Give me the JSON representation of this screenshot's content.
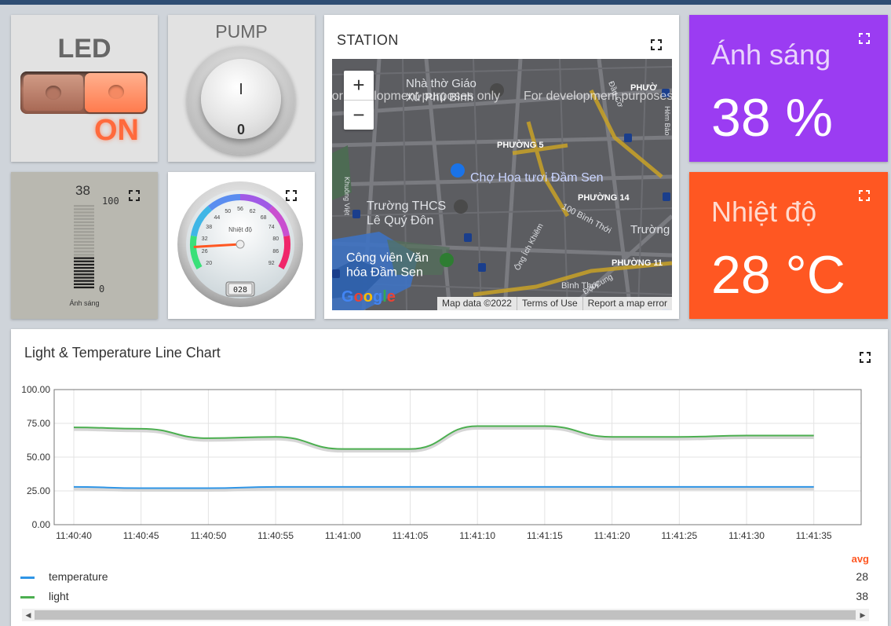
{
  "led": {
    "title": "LED",
    "state": "ON"
  },
  "pump": {
    "title": "PUMP",
    "on_symbol": "I",
    "off_symbol": "0"
  },
  "bar_gauge": {
    "value": "38",
    "max": "100",
    "min": "0",
    "label": "Ánh sáng",
    "level": 0.38
  },
  "dial_gauge": {
    "title": "Nhiệt độ",
    "ticks": [
      "20",
      "26",
      "32",
      "38",
      "44",
      "50",
      "56",
      "62",
      "68",
      "74",
      "80",
      "86",
      "92"
    ],
    "readout": "028",
    "value": 28
  },
  "station": {
    "title": "STATION",
    "zoom_in": "+",
    "zoom_out": "−",
    "labels": {
      "church": "Nhà thờ Giáo\nXứ Phú Bình",
      "dev1": "For development purposes only",
      "dev2": "For development purposes",
      "ward5": "PHƯỜNG 5",
      "ward14": "PHƯỜNG 14",
      "ward11": "PHƯỜNG 11",
      "ward_cut": "PHƯỜ",
      "market": "Chợ Hoa tươi Đầm Sen",
      "school": "Trường THCS\nLê Quý Đôn",
      "park": "Công viên Văn\nhóa Đầm Sen",
      "street_binhthoi": "100 Bình Thới",
      "street_binhthoi2": "Bình Thới",
      "street_ongich": "Ông Ích Khiêm",
      "street_daico": "Đội Cung",
      "street_dauco": "Đầu Cơ",
      "street_khuongviet": "Khuông Việt",
      "street_hem": "Hẻm Bảo",
      "truong": "Trường"
    },
    "logo": "Google",
    "attribution": [
      "Map data ©2022",
      "Terms of Use",
      "Report a map error"
    ]
  },
  "light_tile": {
    "name": "Ánh sáng",
    "value": "38 %",
    "color": "#9b3cf2"
  },
  "temp_tile": {
    "name": "Nhiệt độ",
    "value": "28 °C",
    "color": "#ff5722"
  },
  "chart_title": "Light & Temperature Line Chart",
  "chart_data": {
    "type": "line",
    "x": [
      "11:40:40",
      "11:40:45",
      "11:40:50",
      "11:40:55",
      "11:41:00",
      "11:41:05",
      "11:41:10",
      "11:41:15",
      "11:41:20",
      "11:41:25",
      "11:41:30",
      "11:41:35"
    ],
    "ylim": [
      0,
      100
    ],
    "yticks": [
      "0.00",
      "25.00",
      "50.00",
      "75.00",
      "100.00"
    ],
    "series": [
      {
        "name": "temperature",
        "color": "#2f95e6",
        "values": [
          28,
          27,
          27,
          28,
          28,
          28,
          28,
          28,
          28,
          28,
          28,
          28
        ]
      },
      {
        "name": "light",
        "color": "#4caf50",
        "values": [
          72,
          71,
          64,
          65,
          56,
          56,
          73,
          73,
          65,
          65,
          66,
          66
        ]
      }
    ],
    "legend_header": "avg",
    "averages": [
      "28",
      "38"
    ]
  }
}
